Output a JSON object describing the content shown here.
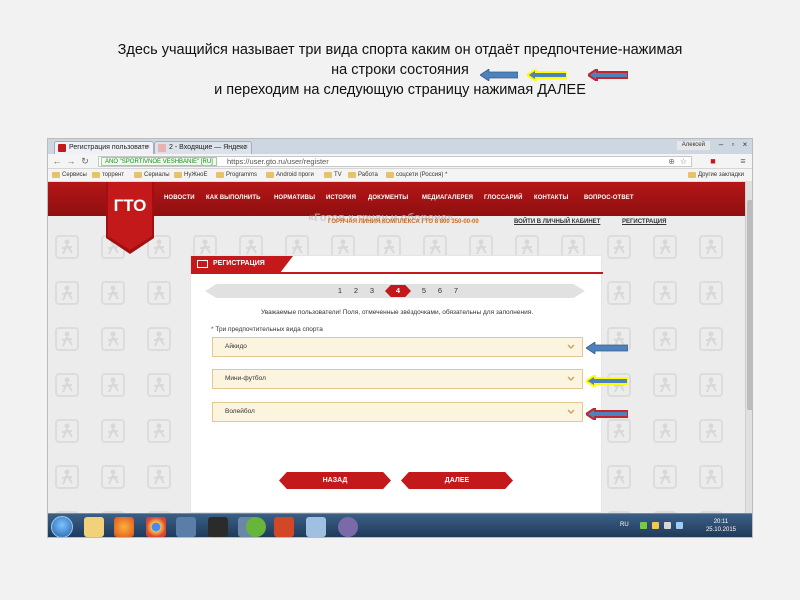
{
  "caption": {
    "line1": "Здесь учащийся называет три вида спорта каким он отдаёт предпочтение-нажимая",
    "line2": "на строки состояния",
    "line3": "и переходим на следующую  страницу нажимая ДАЛЕЕ"
  },
  "browser": {
    "tabs": [
      {
        "label": "Регистрация пользовате"
      },
      {
        "label": "2 - Входящие — Яндекс"
      }
    ],
    "user": "Алексей",
    "secure_label": "ANO \"SPORTIVNOE VESHBANIE\" [RU]",
    "url": "https://user.gto.ru/user/register",
    "bookmarks": [
      "Сервисы",
      "торрент",
      "Сериалы",
      "НуЖноЕ",
      "Programms",
      "Android проги",
      "TV",
      "Работа",
      "соцсети (Россия) *",
      "Другие закладки"
    ]
  },
  "site": {
    "logo": "ГТО",
    "menu": [
      "НОВОСТИ",
      "КАК ВЫПОЛНИТЬ",
      "НОРМАТИВЫ",
      "ИСТОРИЯ",
      "ДОКУМЕНТЫ",
      "МЕДИАГАЛЕРЕЯ",
      "ГЛОССАРИЙ",
      "КОНТАКТЫ",
      "ВОПРОС-ОТВЕТ"
    ],
    "slogan": "«Готов к труду и обороне»",
    "hotline": "ГОРЯЧАЯ ЛИНИЯ КОМПЛЕКСА ГТО 8 800 350-00-00",
    "login": "ВОЙТИ В ЛИЧНЫЙ КАБИНЕТ",
    "register": "РЕГИСТРАЦИЯ"
  },
  "form": {
    "title": "РЕГИСТРАЦИЯ",
    "steps": [
      "1",
      "2",
      "3",
      "4",
      "5",
      "6",
      "7"
    ],
    "current_step": "4",
    "notice": "Уважаемые пользователи! Поля, отмеченные звёздочками, обязательны для заполнения.",
    "required_mark": "*",
    "field_label": "Три предпочтительных вида спорта",
    "sports": [
      "Айкидо",
      "Мини-футбол",
      "Волейбол"
    ],
    "back_label": "НАЗАД",
    "next_label": "ДАЛЕЕ"
  },
  "taskbar": {
    "lang": "RU",
    "time": "20:11",
    "date": "25.10.2015"
  },
  "colors": {
    "brand_red": "#c3191a",
    "arrow_blue": "#4f81bd",
    "arrow_yellow": "#ffff00",
    "arrow_red": "#c0272d"
  }
}
